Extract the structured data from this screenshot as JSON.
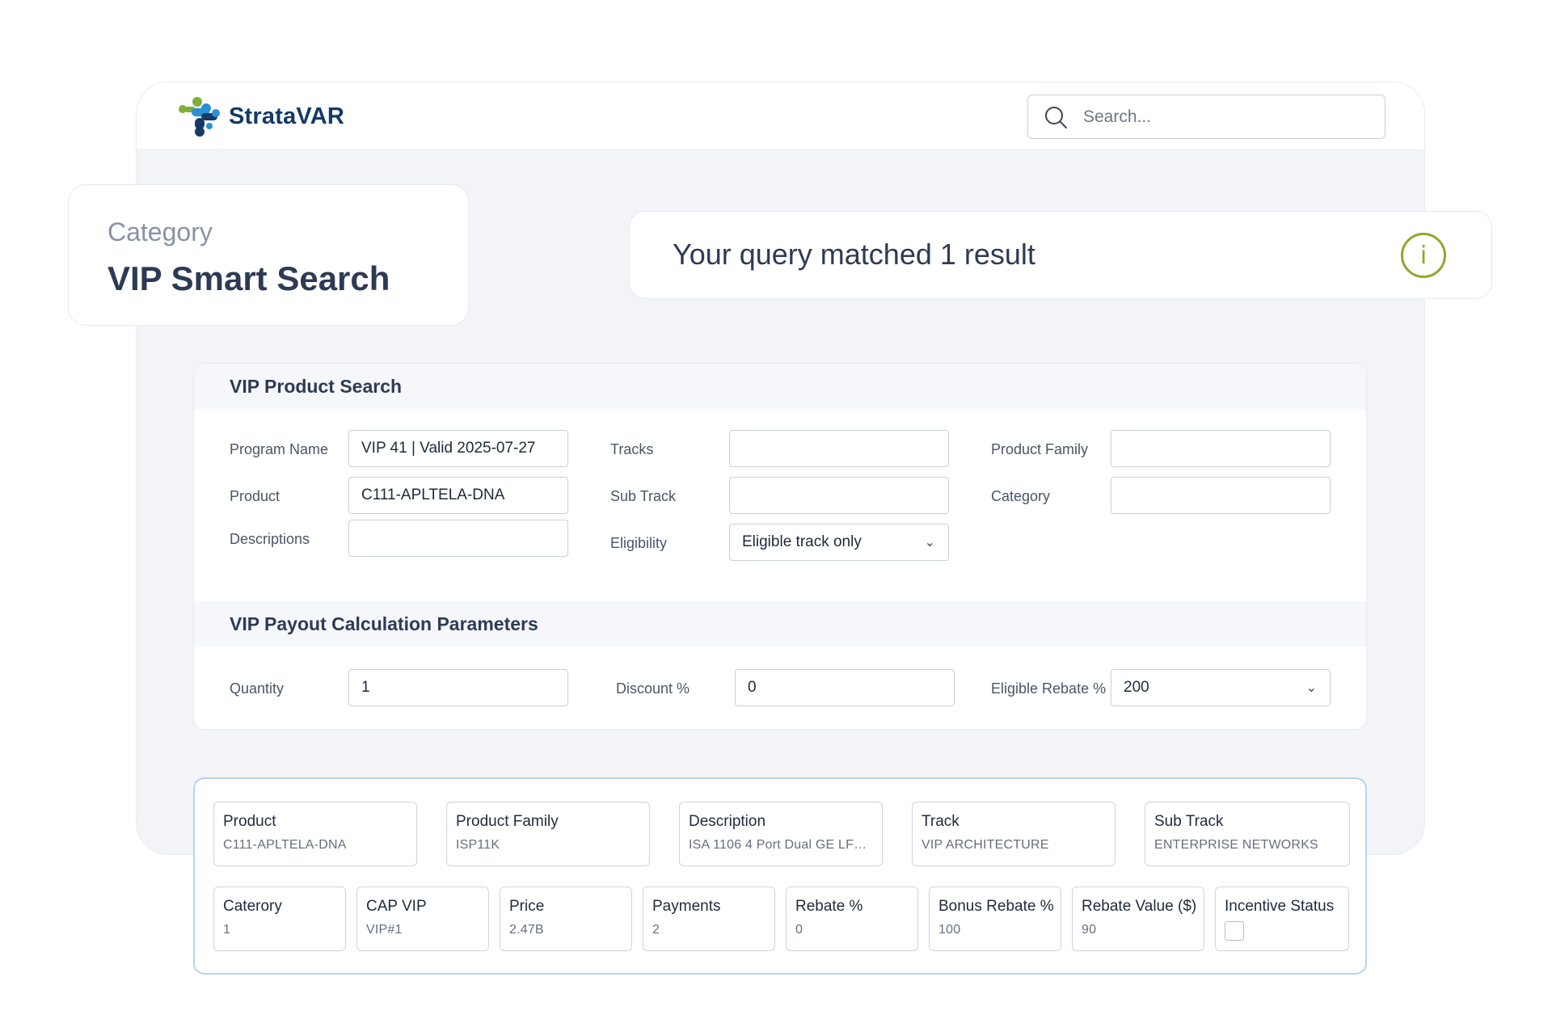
{
  "app": {
    "brand": "StrataVAR",
    "search_placeholder": "Search..."
  },
  "category_card": {
    "label": "Category",
    "title": "VIP Smart Search"
  },
  "result_banner": {
    "text": "Your query matched 1 result",
    "icon": "info-icon",
    "icon_glyph": "i"
  },
  "product_search": {
    "title": "VIP Product Search",
    "program_name": {
      "label": "Program Name",
      "value": "VIP 41 | Valid 2025-07-27"
    },
    "product": {
      "label": "Product",
      "value": "C111-APLTELA-DNA"
    },
    "descriptions": {
      "label": "Descriptions",
      "value": ""
    },
    "tracks": {
      "label": "Tracks",
      "value": ""
    },
    "sub_track": {
      "label": "Sub Track",
      "value": ""
    },
    "eligibility": {
      "label": "Eligibility",
      "value": "Eligible track only"
    },
    "product_family": {
      "label": "Product Family",
      "value": ""
    },
    "category": {
      "label": "Category",
      "value": ""
    }
  },
  "payout": {
    "title": "VIP Payout Calculation Parameters",
    "quantity": {
      "label": "Quantity",
      "value": "1"
    },
    "discount": {
      "label": "Discount %",
      "value": "0"
    },
    "eligible_rebate": {
      "label": "Eligible Rebate %",
      "value": "200"
    }
  },
  "results": {
    "product": {
      "label": "Product",
      "value": "C111-APLTELA-DNA"
    },
    "product_family": {
      "label": "Product Family",
      "value": "ISP11K"
    },
    "description": {
      "label": "Description",
      "value": "ISA 1106 4 Port Dual GE LFE..."
    },
    "track": {
      "label": "Track",
      "value": "VIP ARCHITECTURE"
    },
    "sub_track": {
      "label": "Sub Track",
      "value": "ENTERPRISE NETWORKS"
    },
    "caterory": {
      "label": "Caterory",
      "value": "1"
    },
    "cap_vip": {
      "label": "CAP VIP",
      "value": "VIP#1"
    },
    "price": {
      "label": "Price",
      "value": "2.47B"
    },
    "payments": {
      "label": "Payments",
      "value": "2"
    },
    "rebate_pct": {
      "label": "Rebate %",
      "value": "0"
    },
    "bonus_rebate_pct": {
      "label": "Bonus Rebate %",
      "value": "100"
    },
    "rebate_value": {
      "label": "Rebate Value ($)",
      "value": "90"
    },
    "incentive_status": {
      "label": "Incentive Status",
      "checked": false
    }
  },
  "colors": {
    "brand_navy": "#143a66",
    "info_accent": "#8fa72c",
    "results_border": "#b9d3ea"
  },
  "icons": {
    "chevron": "chevron-down-icon",
    "search": "search-icon",
    "logo": "stratavar-logo-icon"
  }
}
